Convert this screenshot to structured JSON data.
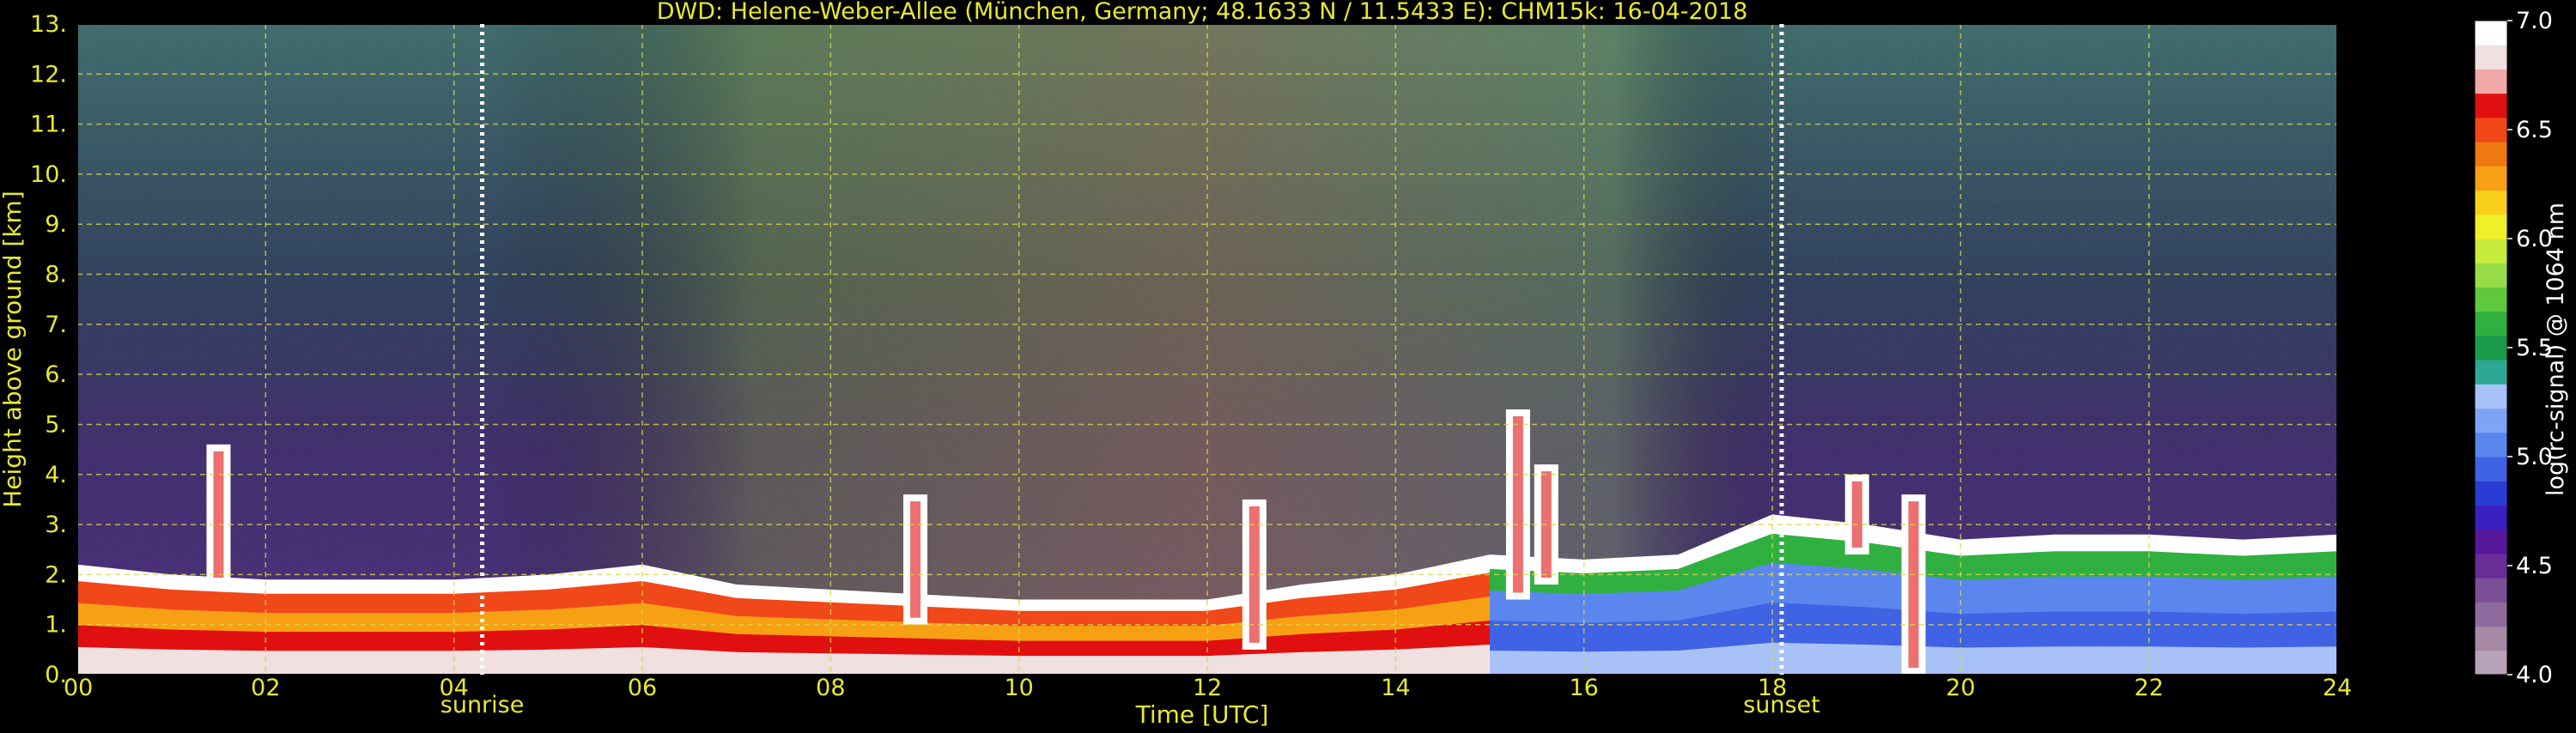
{
  "chart_data": {
    "type": "heatmap",
    "title": "DWD: Helene-Weber-Allee (München, Germany; 48.1633 N / 11.5433 E):    CHM15k: 16-04-2018",
    "xlabel": "Time [UTC]",
    "ylabel": "Height above ground [km]",
    "colorbar_label": "log(rc-signal) @ 1064 nm",
    "xlim": [
      0,
      24
    ],
    "ylim": [
      0,
      13
    ],
    "clim": [
      4.0,
      7.0
    ],
    "grid": true,
    "x_ticks": [
      0,
      2,
      4,
      6,
      8,
      10,
      12,
      14,
      16,
      18,
      20,
      22,
      24
    ],
    "x_tick_labels": [
      "00",
      "02",
      "04",
      "06",
      "08",
      "10",
      "12",
      "14",
      "16",
      "18",
      "20",
      "22",
      "24"
    ],
    "y_ticks": [
      0,
      1,
      2,
      3,
      4,
      5,
      6,
      7,
      8,
      9,
      10,
      11,
      12,
      13
    ],
    "y_tick_labels": [
      "0.",
      "1.",
      "2.",
      "3.",
      "4.",
      "5.",
      "6.",
      "7.",
      "8.",
      "9.",
      "10.",
      "11.",
      "12.",
      "13."
    ],
    "colorbar_ticks": [
      4.0,
      4.5,
      5.0,
      5.5,
      6.0,
      6.5,
      7.0
    ],
    "colorbar_tick_labels": [
      "4.0",
      "4.5",
      "5.0",
      "5.5",
      "6.0",
      "6.5",
      "7.0"
    ],
    "colorbar_colors": [
      "#b8a2b8",
      "#a68aa6",
      "#8e6b9e",
      "#7a4f96",
      "#6a2c96",
      "#58189a",
      "#3c1fc0",
      "#2a3cd4",
      "#3f63e4",
      "#5a86ee",
      "#7ea4f4",
      "#a8c2f8",
      "#2ea894",
      "#1a9a48",
      "#30b040",
      "#60c83c",
      "#98dc48",
      "#c8ec3c",
      "#f0f02a",
      "#f8d01c",
      "#f8a014",
      "#f07810",
      "#f04818",
      "#e01010",
      "#f0a8a8",
      "#f0e0e0",
      "#ffffff"
    ],
    "markers": [
      {
        "label": "sunrise",
        "time": 4.3
      },
      {
        "label": "sunset",
        "time": 18.1
      }
    ],
    "layers": {
      "boundary_layer_top_km": [
        [
          0,
          2.2
        ],
        [
          1,
          2.0
        ],
        [
          2,
          1.9
        ],
        [
          3,
          1.9
        ],
        [
          4,
          1.9
        ],
        [
          5,
          2.0
        ],
        [
          6,
          2.2
        ],
        [
          7,
          1.8
        ],
        [
          8,
          1.7
        ],
        [
          9,
          1.6
        ],
        [
          10,
          1.5
        ],
        [
          11,
          1.5
        ],
        [
          12,
          1.5
        ],
        [
          13,
          1.8
        ],
        [
          14,
          2.0
        ],
        [
          15,
          2.4
        ],
        [
          16,
          2.3
        ],
        [
          17,
          2.4
        ],
        [
          18,
          3.2
        ],
        [
          19,
          3.0
        ],
        [
          20,
          2.7
        ],
        [
          21,
          2.8
        ],
        [
          22,
          2.8
        ],
        [
          23,
          2.7
        ],
        [
          24,
          2.8
        ]
      ],
      "cloud_events": [
        {
          "time": 15.3,
          "base_km": 1.5,
          "top_km": 5.3
        },
        {
          "time": 15.6,
          "base_km": 1.8,
          "top_km": 4.2
        },
        {
          "time": 18.9,
          "base_km": 2.4,
          "top_km": 4.0
        },
        {
          "time": 19.5,
          "base_km": 0.0,
          "top_km": 3.6
        },
        {
          "time": 1.5,
          "base_km": 1.8,
          "top_km": 4.6
        },
        {
          "time": 8.9,
          "base_km": 1.0,
          "top_km": 3.6
        },
        {
          "time": 12.5,
          "base_km": 0.5,
          "top_km": 3.5
        }
      ]
    }
  }
}
